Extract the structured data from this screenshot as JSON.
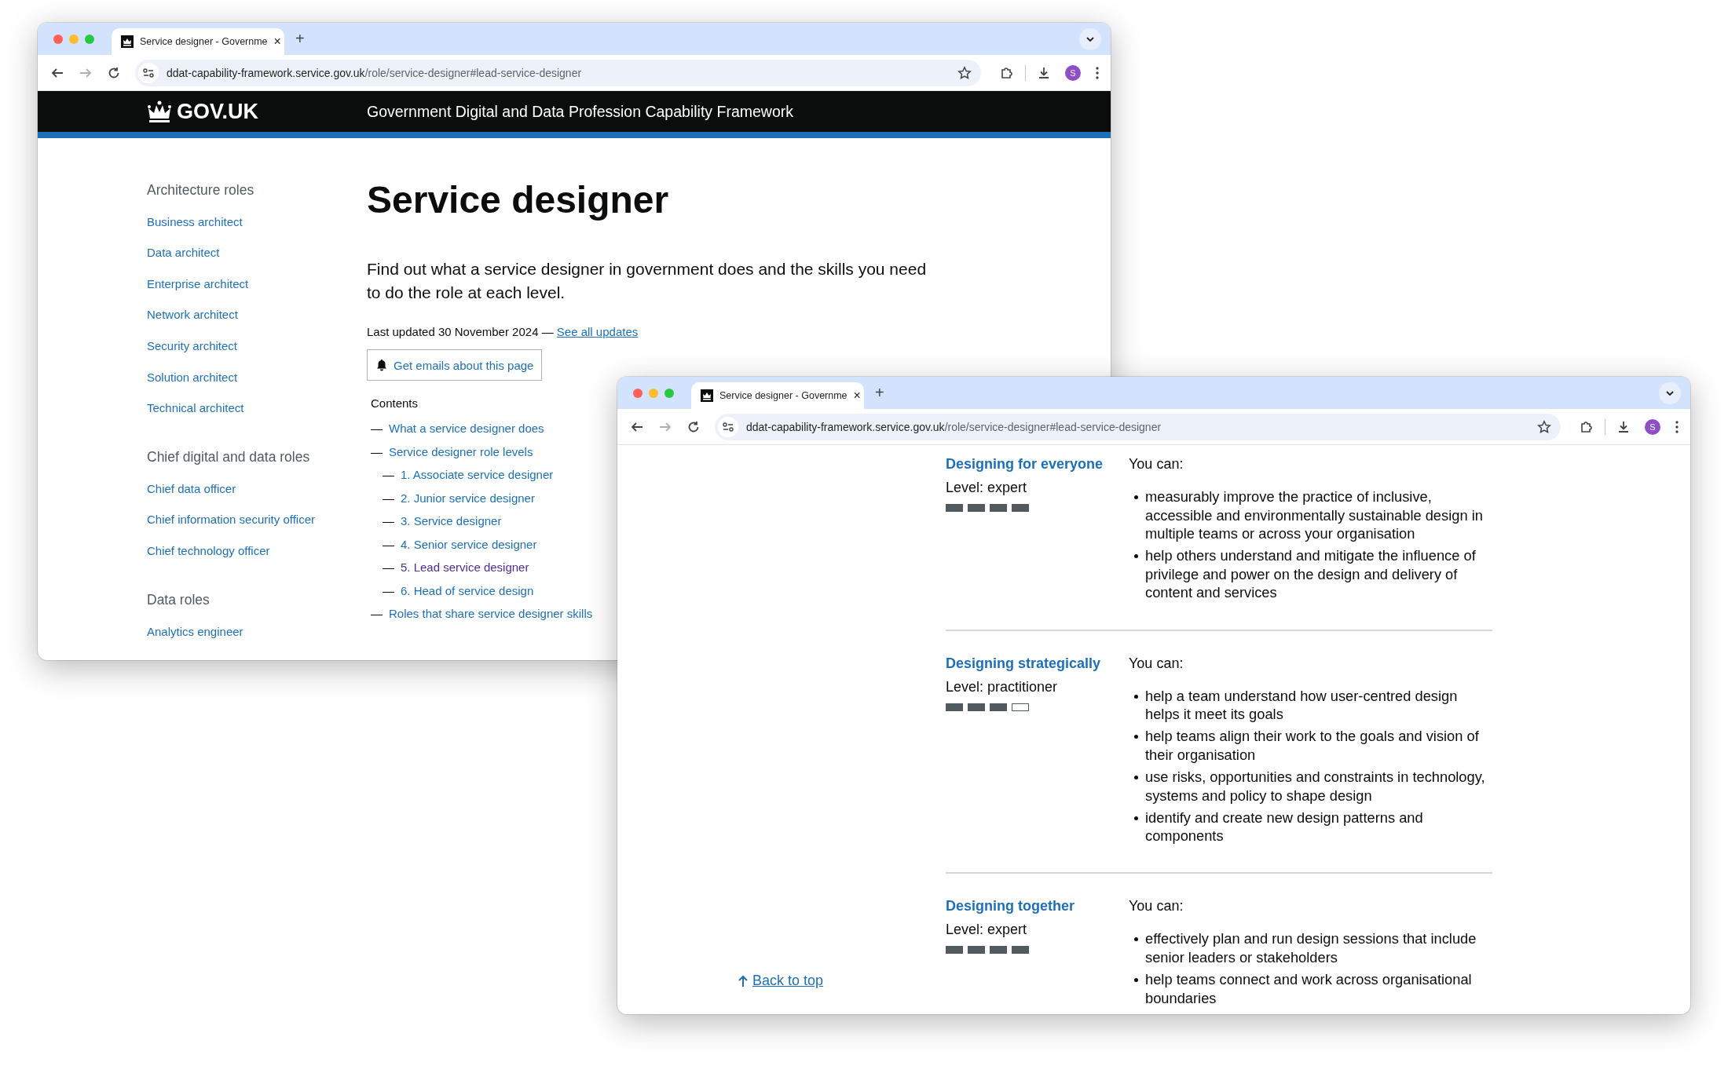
{
  "windows": [
    {
      "kind": "overview",
      "tab": {
        "title": "Service designer - Governme",
        "close": "×"
      },
      "new_tab": "+",
      "forward_disabled": true,
      "address": {
        "host": "ddat-capability-framework.service.gov.uk",
        "path": "/role/service-designer#lead-service-designer"
      },
      "avatar": "S",
      "page": {
        "logo": "GOV.UK",
        "service_name": "Government Digital and Data Profession Capability Framework",
        "sidebar": [
          {
            "heading": "Architecture roles",
            "links": [
              "Business architect",
              "Data architect",
              "Enterprise architect",
              "Network architect",
              "Security architect",
              "Solution architect",
              "Technical architect"
            ]
          },
          {
            "heading": "Chief digital and data roles",
            "links": [
              "Chief data officer",
              "Chief information security officer",
              "Chief technology officer"
            ]
          },
          {
            "heading": "Data roles",
            "links": [
              "Analytics engineer"
            ]
          }
        ],
        "title": "Service designer",
        "lead": "Find out what a service designer in government does and the skills you need to do the role at each level.",
        "updated": "Last updated 30 November 2024 —",
        "updates_link": "See all updates",
        "email_button": "Get emails about this page",
        "contents_heading": "Contents",
        "contents": [
          {
            "dash": "—",
            "label": "What a service designer does",
            "visited": false
          },
          {
            "dash": "—",
            "label": "Service designer role levels",
            "visited": false,
            "children": [
              {
                "dash": "—",
                "label": "1. Associate service designer",
                "visited": false
              },
              {
                "dash": "—",
                "label": "2. Junior service designer",
                "visited": false
              },
              {
                "dash": "—",
                "label": "3. Service designer",
                "visited": false
              },
              {
                "dash": "—",
                "label": "4. Senior service designer",
                "visited": false
              },
              {
                "dash": "—",
                "label": "5. Lead service designer",
                "visited": true
              },
              {
                "dash": "—",
                "label": "6. Head of service design",
                "visited": false
              }
            ]
          },
          {
            "dash": "—",
            "label": "Roles that share service designer skills",
            "visited": false
          }
        ]
      }
    },
    {
      "kind": "skills",
      "tab": {
        "title": "Service designer - Governme",
        "close": "×"
      },
      "new_tab": "+",
      "forward_disabled": true,
      "address": {
        "host": "ddat-capability-framework.service.gov.uk",
        "path": "/role/service-designer#lead-service-designer"
      },
      "avatar": "S",
      "page": {
        "back_to_top": "Back to top",
        "skills": [
          {
            "name": "Designing for everyone",
            "level_label": "Level: expert",
            "stars": 4,
            "intro": "You can:",
            "points": [
              "measurably improve the practice of inclusive, accessible and environmentally sustainable design in multiple teams or across your organisation",
              "help others understand and mitigate the influence of privilege and power on the design and delivery of content and services"
            ]
          },
          {
            "name": "Designing strategically",
            "level_label": "Level: practitioner",
            "stars": 3,
            "intro": "You can:",
            "points": [
              "help a team understand how user-centred design helps it meet its goals",
              "help teams align their work to the goals and vision of their organisation",
              "use risks, opportunities and constraints in technology, systems and policy to shape design",
              "identify and create new design patterns and components"
            ]
          },
          {
            "name": "Designing together",
            "level_label": "Level: expert",
            "stars": 4,
            "intro": "You can:",
            "points": [
              "effectively plan and run design sessions that include senior leaders or stakeholders",
              "help teams connect and work across organisational boundaries"
            ]
          }
        ]
      }
    }
  ]
}
